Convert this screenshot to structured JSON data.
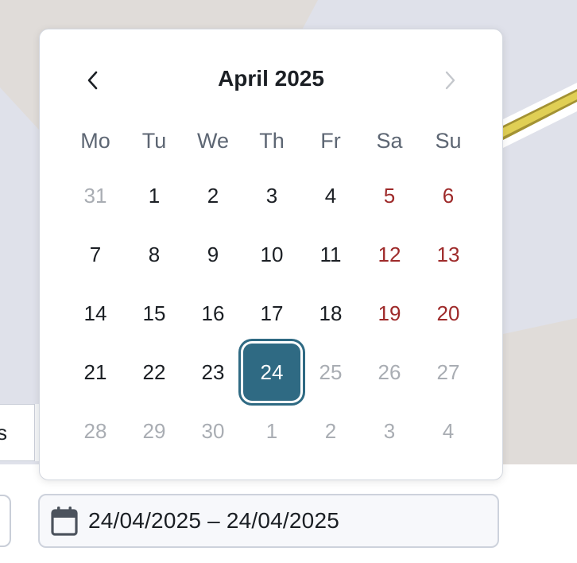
{
  "colors": {
    "accent": "#2f6a83",
    "weekend": "#9e2a2a",
    "muted": "#a9adb3",
    "text": "#1b1f24",
    "weekday_header": "#5d6673"
  },
  "calendar": {
    "title": "April 2025",
    "prev_icon": "chevron-left-icon",
    "next_icon": "chevron-right-icon",
    "weekdays": [
      "Mo",
      "Tu",
      "We",
      "Th",
      "Fr",
      "Sa",
      "Su"
    ],
    "weeks": [
      [
        {
          "d": "31",
          "s": "muted"
        },
        {
          "d": "1",
          "s": "normal"
        },
        {
          "d": "2",
          "s": "normal"
        },
        {
          "d": "3",
          "s": "normal"
        },
        {
          "d": "4",
          "s": "normal"
        },
        {
          "d": "5",
          "s": "weekend"
        },
        {
          "d": "6",
          "s": "weekend"
        }
      ],
      [
        {
          "d": "7",
          "s": "normal"
        },
        {
          "d": "8",
          "s": "normal"
        },
        {
          "d": "9",
          "s": "normal"
        },
        {
          "d": "10",
          "s": "normal"
        },
        {
          "d": "11",
          "s": "normal"
        },
        {
          "d": "12",
          "s": "weekend"
        },
        {
          "d": "13",
          "s": "weekend"
        }
      ],
      [
        {
          "d": "14",
          "s": "normal"
        },
        {
          "d": "15",
          "s": "normal"
        },
        {
          "d": "16",
          "s": "normal"
        },
        {
          "d": "17",
          "s": "normal"
        },
        {
          "d": "18",
          "s": "normal"
        },
        {
          "d": "19",
          "s": "weekend"
        },
        {
          "d": "20",
          "s": "weekend"
        }
      ],
      [
        {
          "d": "21",
          "s": "normal"
        },
        {
          "d": "22",
          "s": "normal"
        },
        {
          "d": "23",
          "s": "normal"
        },
        {
          "d": "24",
          "s": "selected"
        },
        {
          "d": "25",
          "s": "muted"
        },
        {
          "d": "26",
          "s": "muted"
        },
        {
          "d": "27",
          "s": "muted"
        }
      ],
      [
        {
          "d": "28",
          "s": "muted"
        },
        {
          "d": "29",
          "s": "muted"
        },
        {
          "d": "30",
          "s": "muted"
        },
        {
          "d": "1",
          "s": "muted"
        },
        {
          "d": "2",
          "s": "muted"
        },
        {
          "d": "3",
          "s": "muted"
        },
        {
          "d": "4",
          "s": "muted"
        }
      ]
    ]
  },
  "date_field": {
    "icon": "calendar-icon",
    "value": "24/04/2025 – 24/04/2025"
  },
  "left_tab": {
    "label": "s"
  }
}
